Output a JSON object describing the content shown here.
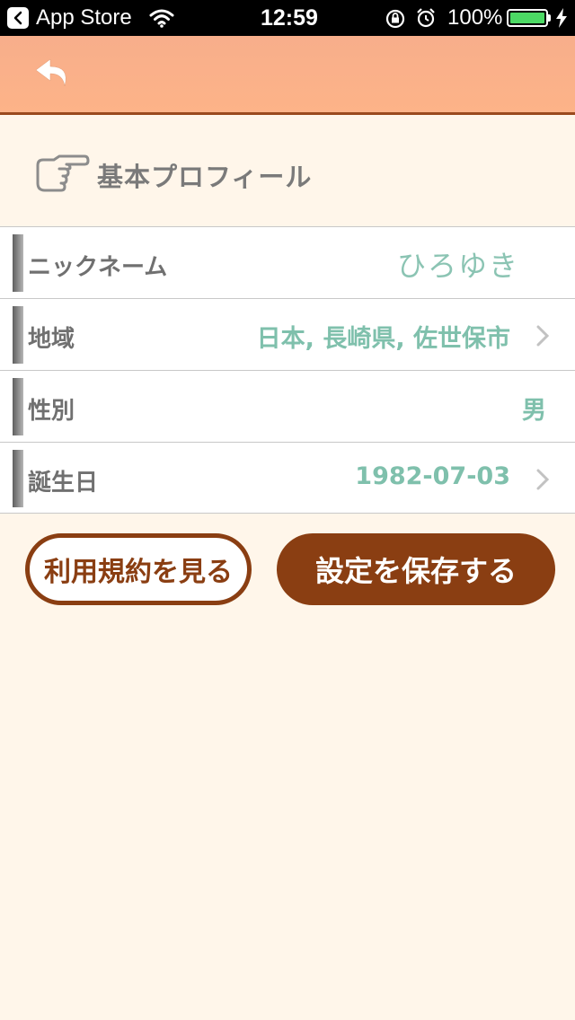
{
  "status_bar": {
    "app_name": "App Store",
    "time": "12:59",
    "battery_percent": "100%"
  },
  "nav": {
    "back_icon": "undo-arrow-icon"
  },
  "section": {
    "icon": "pointing-hand-icon",
    "title": "基本プロフィール"
  },
  "profile_rows": [
    {
      "label": "ニックネーム",
      "value": "ひろゆき"
    },
    {
      "label": "地域",
      "value": "日本, 長崎県, 佐世保市"
    },
    {
      "label": "性別",
      "value": "男"
    },
    {
      "label": "誕生日",
      "value": "1982-07-03"
    }
  ],
  "buttons": {
    "terms": "利用規約を見る",
    "save": "設定を保存する"
  },
  "colors": {
    "accent_brown": "#8A3E12",
    "nav_orange": "#FDB388",
    "value_teal": "#7FC0AC",
    "background": "#FFF6EA"
  }
}
